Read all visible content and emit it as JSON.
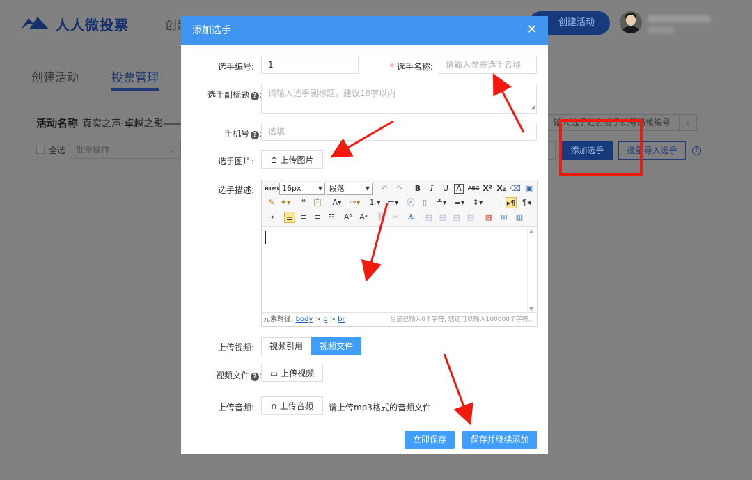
{
  "app": {
    "logo_text": "人人微投票",
    "nav_create": "创建",
    "create_button": "创建活动"
  },
  "page": {
    "tabs": [
      "创建活动",
      "投票管理"
    ],
    "activity_label": "活动名称",
    "activity_name": "真实之声·卓越之影——",
    "select_all": "全选",
    "batch_placeholder": "批量操作",
    "search_placeholder": "输入选手姓名或手机号码或编号",
    "add_player": "添加选手",
    "batch_import": "批量导入选手"
  },
  "modal": {
    "title": "添加选手",
    "fields": {
      "number_label": "选手编号:",
      "number_value": "1",
      "name_label": "选手名称:",
      "name_placeholder": "请输入参赛选手名称",
      "subtitle_label": "选手副标题",
      "subtitle_placeholder": "请输入选手副标题，建议18字以内",
      "phone_label": "手机号",
      "phone_placeholder": "选填",
      "image_label": "选手图片:",
      "image_button": "上传图片",
      "desc_label": "选手描述:",
      "video_label": "上传视频:",
      "video_ref": "视频引用",
      "video_file": "视频文件",
      "video_file_label": "视频文件",
      "video_upload": "上传视频",
      "audio_label": "上传音频:",
      "audio_button": "上传音频",
      "audio_hint": "请上传mp3格式的音频文件"
    },
    "editor": {
      "font_size": "16px",
      "paragraph": "段落",
      "path_label": "元素路径:",
      "path": [
        "body",
        "p",
        "br"
      ],
      "counter": "当前已输入0个字符, 您还可以输入100000个字符。"
    },
    "buttons": {
      "save": "立即保存",
      "save_continue": "保存并继续添加"
    }
  },
  "colors": {
    "modal_header": "#3f95ef",
    "primary": "#409eff",
    "annotation_red": "#f21a0f",
    "overlay": "#7f7f7f"
  }
}
